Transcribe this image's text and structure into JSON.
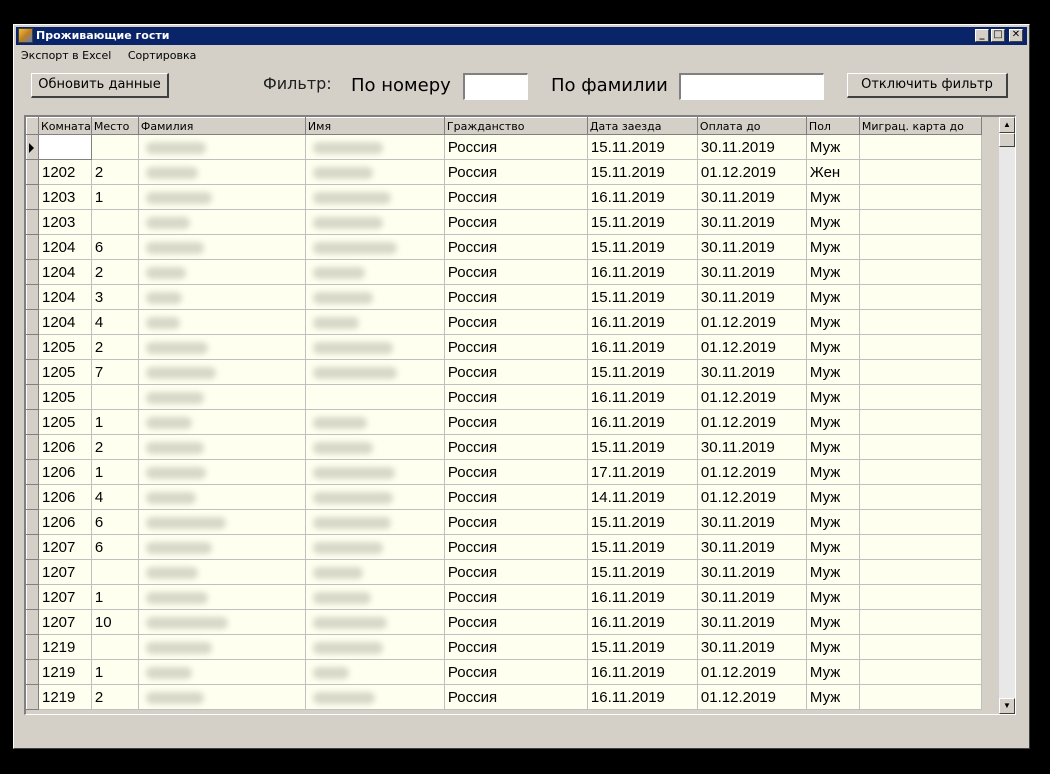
{
  "window": {
    "title": "Проживающие гости"
  },
  "menu": [
    {
      "label": "Экспорт в Excel"
    },
    {
      "label": "Сортировка"
    }
  ],
  "toolbar": {
    "refresh_label": "Обновить данные",
    "filter_label": "Фильтр:",
    "by_number_label": "По номеру",
    "by_number_value": "",
    "by_surname_label": "По фамилии",
    "by_surname_value": "",
    "disable_filter_label": "Отключить фильтр"
  },
  "table": {
    "columns": [
      "Комната",
      "Место",
      "Фамилия",
      "Имя",
      "Гражданство",
      "Дата заезда",
      "Оплата до",
      "Пол",
      "Миграц. карта до"
    ],
    "rows": [
      {
        "room": "",
        "place": "",
        "citizenship": "Россия",
        "checkin": "15.11.2019",
        "paid": "30.11.2019",
        "sex": "Муж"
      },
      {
        "room": "1202",
        "place": "2",
        "citizenship": "Россия",
        "checkin": "15.11.2019",
        "paid": "01.12.2019",
        "sex": "Жен"
      },
      {
        "room": "1203",
        "place": "1",
        "citizenship": "Россия",
        "checkin": "16.11.2019",
        "paid": "30.11.2019",
        "sex": "Муж"
      },
      {
        "room": "1203",
        "place": "",
        "citizenship": "Россия",
        "checkin": "15.11.2019",
        "paid": "30.11.2019",
        "sex": "Муж"
      },
      {
        "room": "1204",
        "place": "6",
        "citizenship": "Россия",
        "checkin": "15.11.2019",
        "paid": "30.11.2019",
        "sex": "Муж"
      },
      {
        "room": "1204",
        "place": "2",
        "citizenship": "Россия",
        "checkin": "16.11.2019",
        "paid": "30.11.2019",
        "sex": "Муж"
      },
      {
        "room": "1204",
        "place": "3",
        "citizenship": "Россия",
        "checkin": "15.11.2019",
        "paid": "30.11.2019",
        "sex": "Муж"
      },
      {
        "room": "1204",
        "place": "4",
        "citizenship": "Россия",
        "checkin": "16.11.2019",
        "paid": "01.12.2019",
        "sex": "Муж"
      },
      {
        "room": "1205",
        "place": "2",
        "citizenship": "Россия",
        "checkin": "16.11.2019",
        "paid": "01.12.2019",
        "sex": "Муж"
      },
      {
        "room": "1205",
        "place": "7",
        "citizenship": "Россия",
        "checkin": "15.11.2019",
        "paid": "30.11.2019",
        "sex": "Муж"
      },
      {
        "room": "1205",
        "place": "",
        "citizenship": "Россия",
        "checkin": "16.11.2019",
        "paid": "01.12.2019",
        "sex": "Муж"
      },
      {
        "room": "1205",
        "place": "1",
        "citizenship": "Россия",
        "checkin": "16.11.2019",
        "paid": "01.12.2019",
        "sex": "Муж"
      },
      {
        "room": "1206",
        "place": "2",
        "citizenship": "Россия",
        "checkin": "15.11.2019",
        "paid": "30.11.2019",
        "sex": "Муж"
      },
      {
        "room": "1206",
        "place": "1",
        "citizenship": "Россия",
        "checkin": "17.11.2019",
        "paid": "01.12.2019",
        "sex": "Муж"
      },
      {
        "room": "1206",
        "place": "4",
        "citizenship": "Россия",
        "checkin": "14.11.2019",
        "paid": "01.12.2019",
        "sex": "Муж"
      },
      {
        "room": "1206",
        "place": "6",
        "citizenship": "Россия",
        "checkin": "15.11.2019",
        "paid": "30.11.2019",
        "sex": "Муж"
      },
      {
        "room": "1207",
        "place": "6",
        "citizenship": "Россия",
        "checkin": "15.11.2019",
        "paid": "30.11.2019",
        "sex": "Муж"
      },
      {
        "room": "1207",
        "place": "",
        "citizenship": "Россия",
        "checkin": "15.11.2019",
        "paid": "30.11.2019",
        "sex": "Муж"
      },
      {
        "room": "1207",
        "place": "1",
        "citizenship": "Россия",
        "checkin": "16.11.2019",
        "paid": "30.11.2019",
        "sex": "Муж"
      },
      {
        "room": "1207",
        "place": "10",
        "citizenship": "Россия",
        "checkin": "16.11.2019",
        "paid": "30.11.2019",
        "sex": "Муж"
      },
      {
        "room": "1219",
        "place": "",
        "citizenship": "Россия",
        "checkin": "15.11.2019",
        "paid": "30.11.2019",
        "sex": "Муж"
      },
      {
        "room": "1219",
        "place": "1",
        "citizenship": "Россия",
        "checkin": "16.11.2019",
        "paid": "01.12.2019",
        "sex": "Муж"
      },
      {
        "room": "1219",
        "place": "2",
        "citizenship": "Россия",
        "checkin": "16.11.2019",
        "paid": "01.12.2019",
        "sex": "Муж"
      }
    ]
  }
}
